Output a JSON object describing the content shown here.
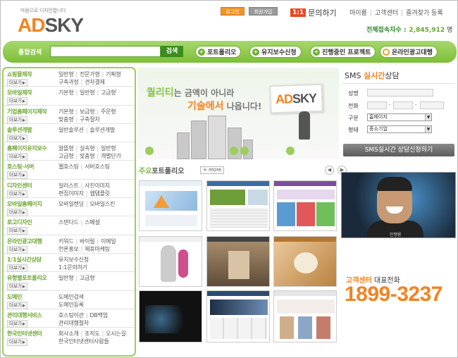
{
  "header": {
    "logo_tagline": "마음으로 디자인합니다",
    "logo_ad": "AD",
    "logo_sky": "SKY",
    "login_label": "로그인",
    "join_label": "회원가입",
    "inquiry_box": "1:1",
    "inquiry_label": "문의하기",
    "links": [
      "마이룸",
      "고객센터",
      "즐겨찾기 등록"
    ],
    "visits_label": "전체접속자수 :",
    "visits_count": "2,845,912",
    "visits_unit": "명"
  },
  "searchbar": {
    "label": "통합검색",
    "button": "검색",
    "pills": [
      "포트폴리오",
      "유지보수신청",
      "진행중인 프로젝트",
      "온라인광고대행"
    ]
  },
  "menu": {
    "more_label": "더보기",
    "items": [
      {
        "name": "쇼핑몰제작",
        "sub1": [
          "일반형",
          "전문가형",
          "기획형"
        ],
        "sub2": [
          "구축과정",
          "견자결제"
        ]
      },
      {
        "name": "모바일제작",
        "sub1": [
          "기본형",
          "일반형",
          "고급형"
        ],
        "sub2": []
      },
      {
        "name": "기업홈페이지제작",
        "sub1": [
          "기본형",
          "보급형",
          "주문형"
        ],
        "sub2": [
          "맞춤형",
          "구축절차"
        ]
      },
      {
        "name": "솔루션개발",
        "sub1": [
          "일반솔루션",
          "솔루션개발"
        ],
        "sub2": []
      },
      {
        "name": "홈페이지유지보수",
        "sub1": [
          "알뜰형",
          "실속형",
          "일반형"
        ],
        "sub2": [
          "고급형",
          "맞춤형",
          "개별단가"
        ]
      },
      {
        "name": "호스팅·서버",
        "sub1": [
          "웹호스팅",
          "서버호스팅"
        ],
        "sub2": []
      },
      {
        "name": "디자인센터",
        "sub1": [
          "일러스트",
          "사진이미지"
        ],
        "sub2": [
          "편집이미지",
          "웹템플릿"
        ]
      },
      {
        "name": "모바일홈페이지",
        "sub1": [
          "모바일랜딩",
          "모바일스킨"
        ],
        "sub2": []
      },
      {
        "name": "로고디자인",
        "sub1": [
          "스탠다드",
          "스페셜"
        ],
        "sub2": []
      },
      {
        "name": "온라인광고대행",
        "sub1": [
          "키워드",
          "바이럴",
          "이메일"
        ],
        "sub2": [
          "언론홍보",
          "제휴마케팅"
        ]
      },
      {
        "name": "1:1실시간상담",
        "sub1": [
          "유지보수신청"
        ],
        "sub2": [
          "1:1문의하기"
        ]
      },
      {
        "name": "유형별포트폴리오",
        "sub1": [
          "일반형",
          "고급형"
        ],
        "sub2": []
      },
      {
        "name": "도메인",
        "sub1": [
          "도메인검색"
        ],
        "sub2": [
          "도메인등록"
        ]
      },
      {
        "name": "관리대행서비스",
        "sub1": [
          "호스팅이관",
          "DB백업"
        ],
        "sub2": [
          "관리대행절차"
        ]
      },
      {
        "name": "한국인터넷센터",
        "sub1": [
          "회사소개",
          "조직도",
          "오시는길"
        ],
        "sub2": [
          "한국인터넷센터사람들"
        ]
      }
    ]
  },
  "banner": {
    "word1": "퀄리티",
    "text1": "는 금액이 아니라",
    "word2": "기술에서",
    "text2": "나옵니다!",
    "sign_ad": "AD",
    "sign_sky": "SKY"
  },
  "portfolio": {
    "title_a": "주요",
    "title_b": "포트폴리오",
    "more": "+ more",
    "prev": "◀",
    "next": "▶"
  },
  "sms": {
    "title_a": "SMS",
    "title_b": "실시간",
    "title_c": "상담",
    "name_label": "성명",
    "phone_label": "전화",
    "type_label": "구분",
    "type_value": "홈페이지",
    "form_label": "형태",
    "form_value": "중소기업",
    "submit": "SMS실시간 상담신청하기"
  },
  "video": {
    "caption": "인맹용"
  },
  "cs": {
    "label_a": "고객센터",
    "label_b": "대표전화",
    "phone": "1899-3237"
  },
  "colors": {
    "brand_orange": "#f58220",
    "brand_green": "#7dbf3a"
  }
}
